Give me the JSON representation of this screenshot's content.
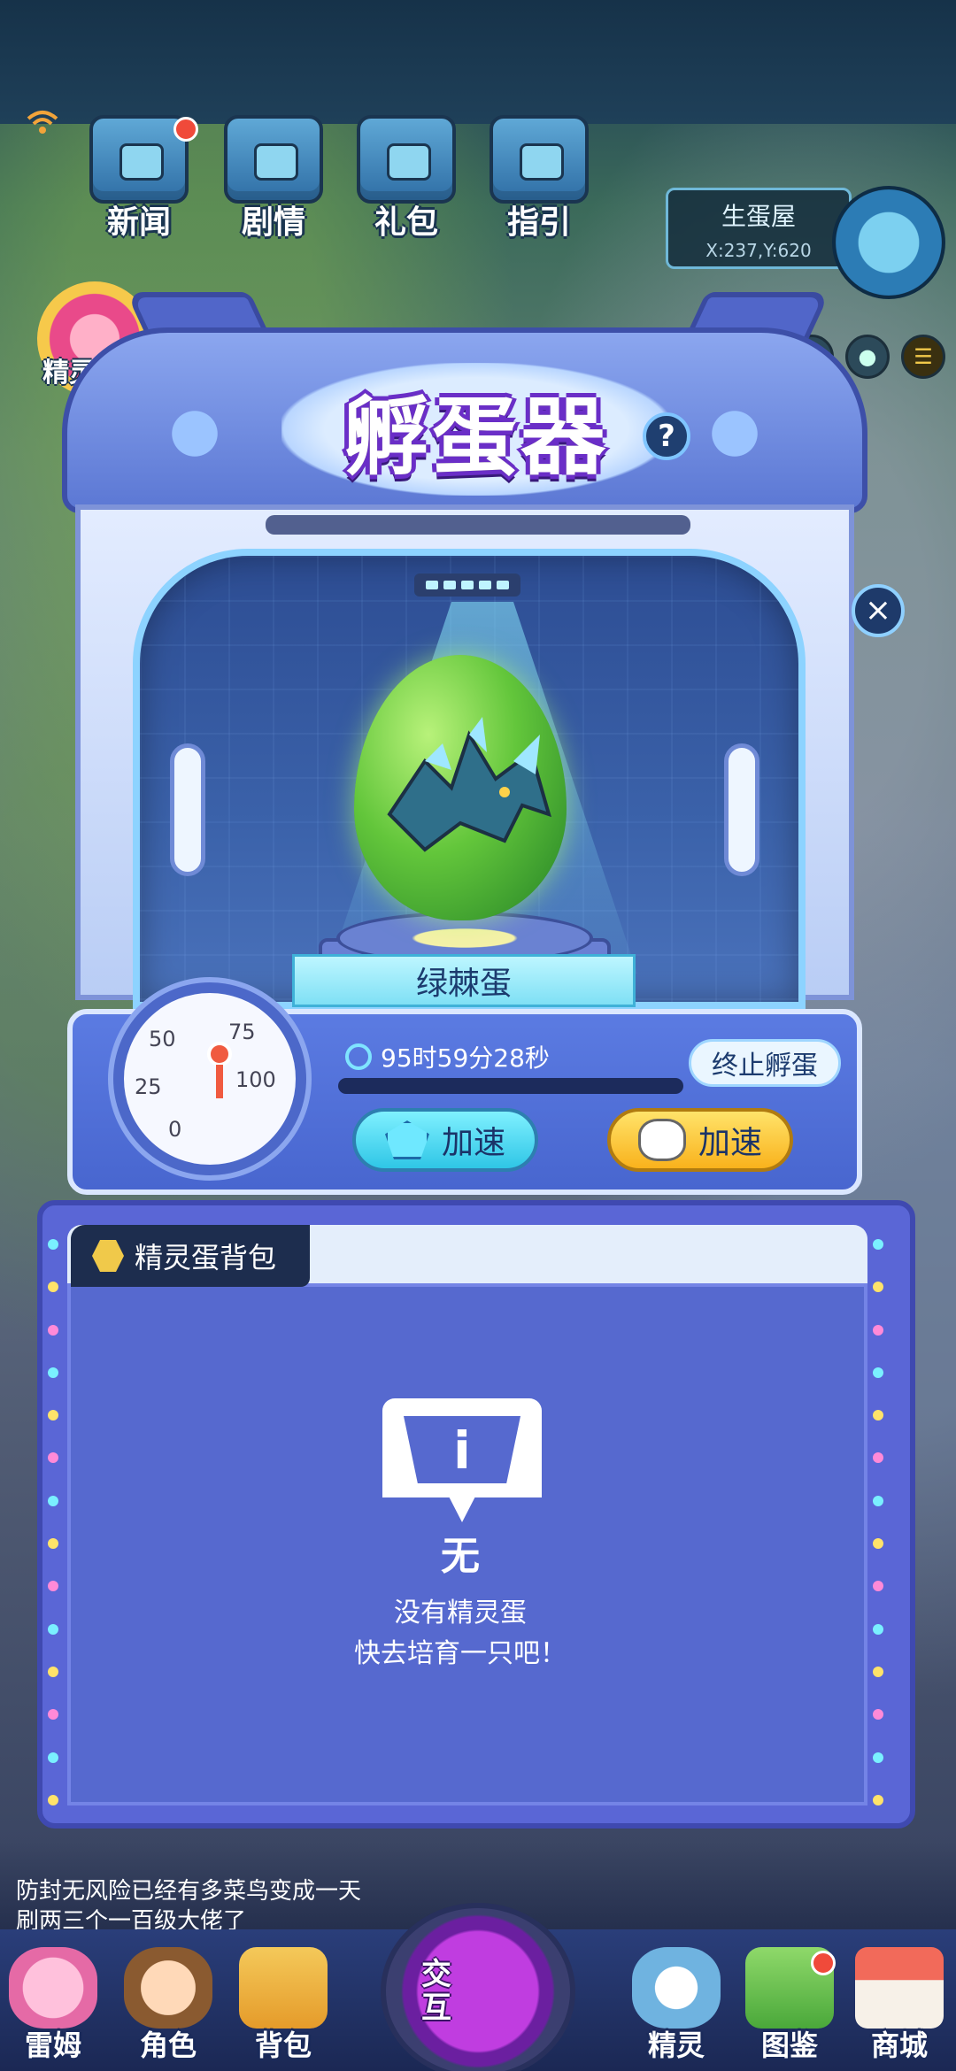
{
  "top_nav": {
    "items": [
      {
        "label": "新闻",
        "icon": "news-tv-icon",
        "badge": true
      },
      {
        "label": "剧情",
        "icon": "story-machine-icon",
        "badge": false
      },
      {
        "label": "礼包",
        "icon": "gift-machine-icon",
        "badge": false
      },
      {
        "label": "指引",
        "icon": "guide-machine-icon",
        "badge": false
      }
    ],
    "battle_pass_label": "精灵战令"
  },
  "location": {
    "name": "生蛋屋",
    "coord": "X:237,Y:620"
  },
  "incubator": {
    "title": "孵蛋器",
    "help_label": "?",
    "egg_name": "绿棘蛋",
    "timer": "95时59分28秒",
    "stop_label": "终止孵蛋",
    "speed_gem_label": "加速",
    "speed_coin_label": "加速",
    "progress": 0.0,
    "gauge_ticks": [
      "0",
      "25",
      "50",
      "75",
      "100"
    ]
  },
  "bag": {
    "tab_label": "精灵蛋背包",
    "empty_title": "无",
    "empty_line1": "没有精灵蛋",
    "empty_line2": "快去培育一只吧！"
  },
  "chat": {
    "line1": "防封无风险已经有多菜鸟变成一天",
    "line2": "刷两三个一百级大佬了"
  },
  "close_label": "×",
  "bottom_nav": {
    "items": [
      {
        "label": "雷姆"
      },
      {
        "label": "角色"
      },
      {
        "label": "背包"
      },
      {
        "label": "精灵"
      },
      {
        "label": "图鉴"
      },
      {
        "label": "商城"
      }
    ],
    "interact_label": "交互"
  },
  "colors": {
    "panel": "#5a66d6",
    "accent_cyan": "#7ff0ff",
    "accent_gold": "#f9b21c",
    "title_purple": "#6a2ec7",
    "egg_green": "#63c63b"
  }
}
